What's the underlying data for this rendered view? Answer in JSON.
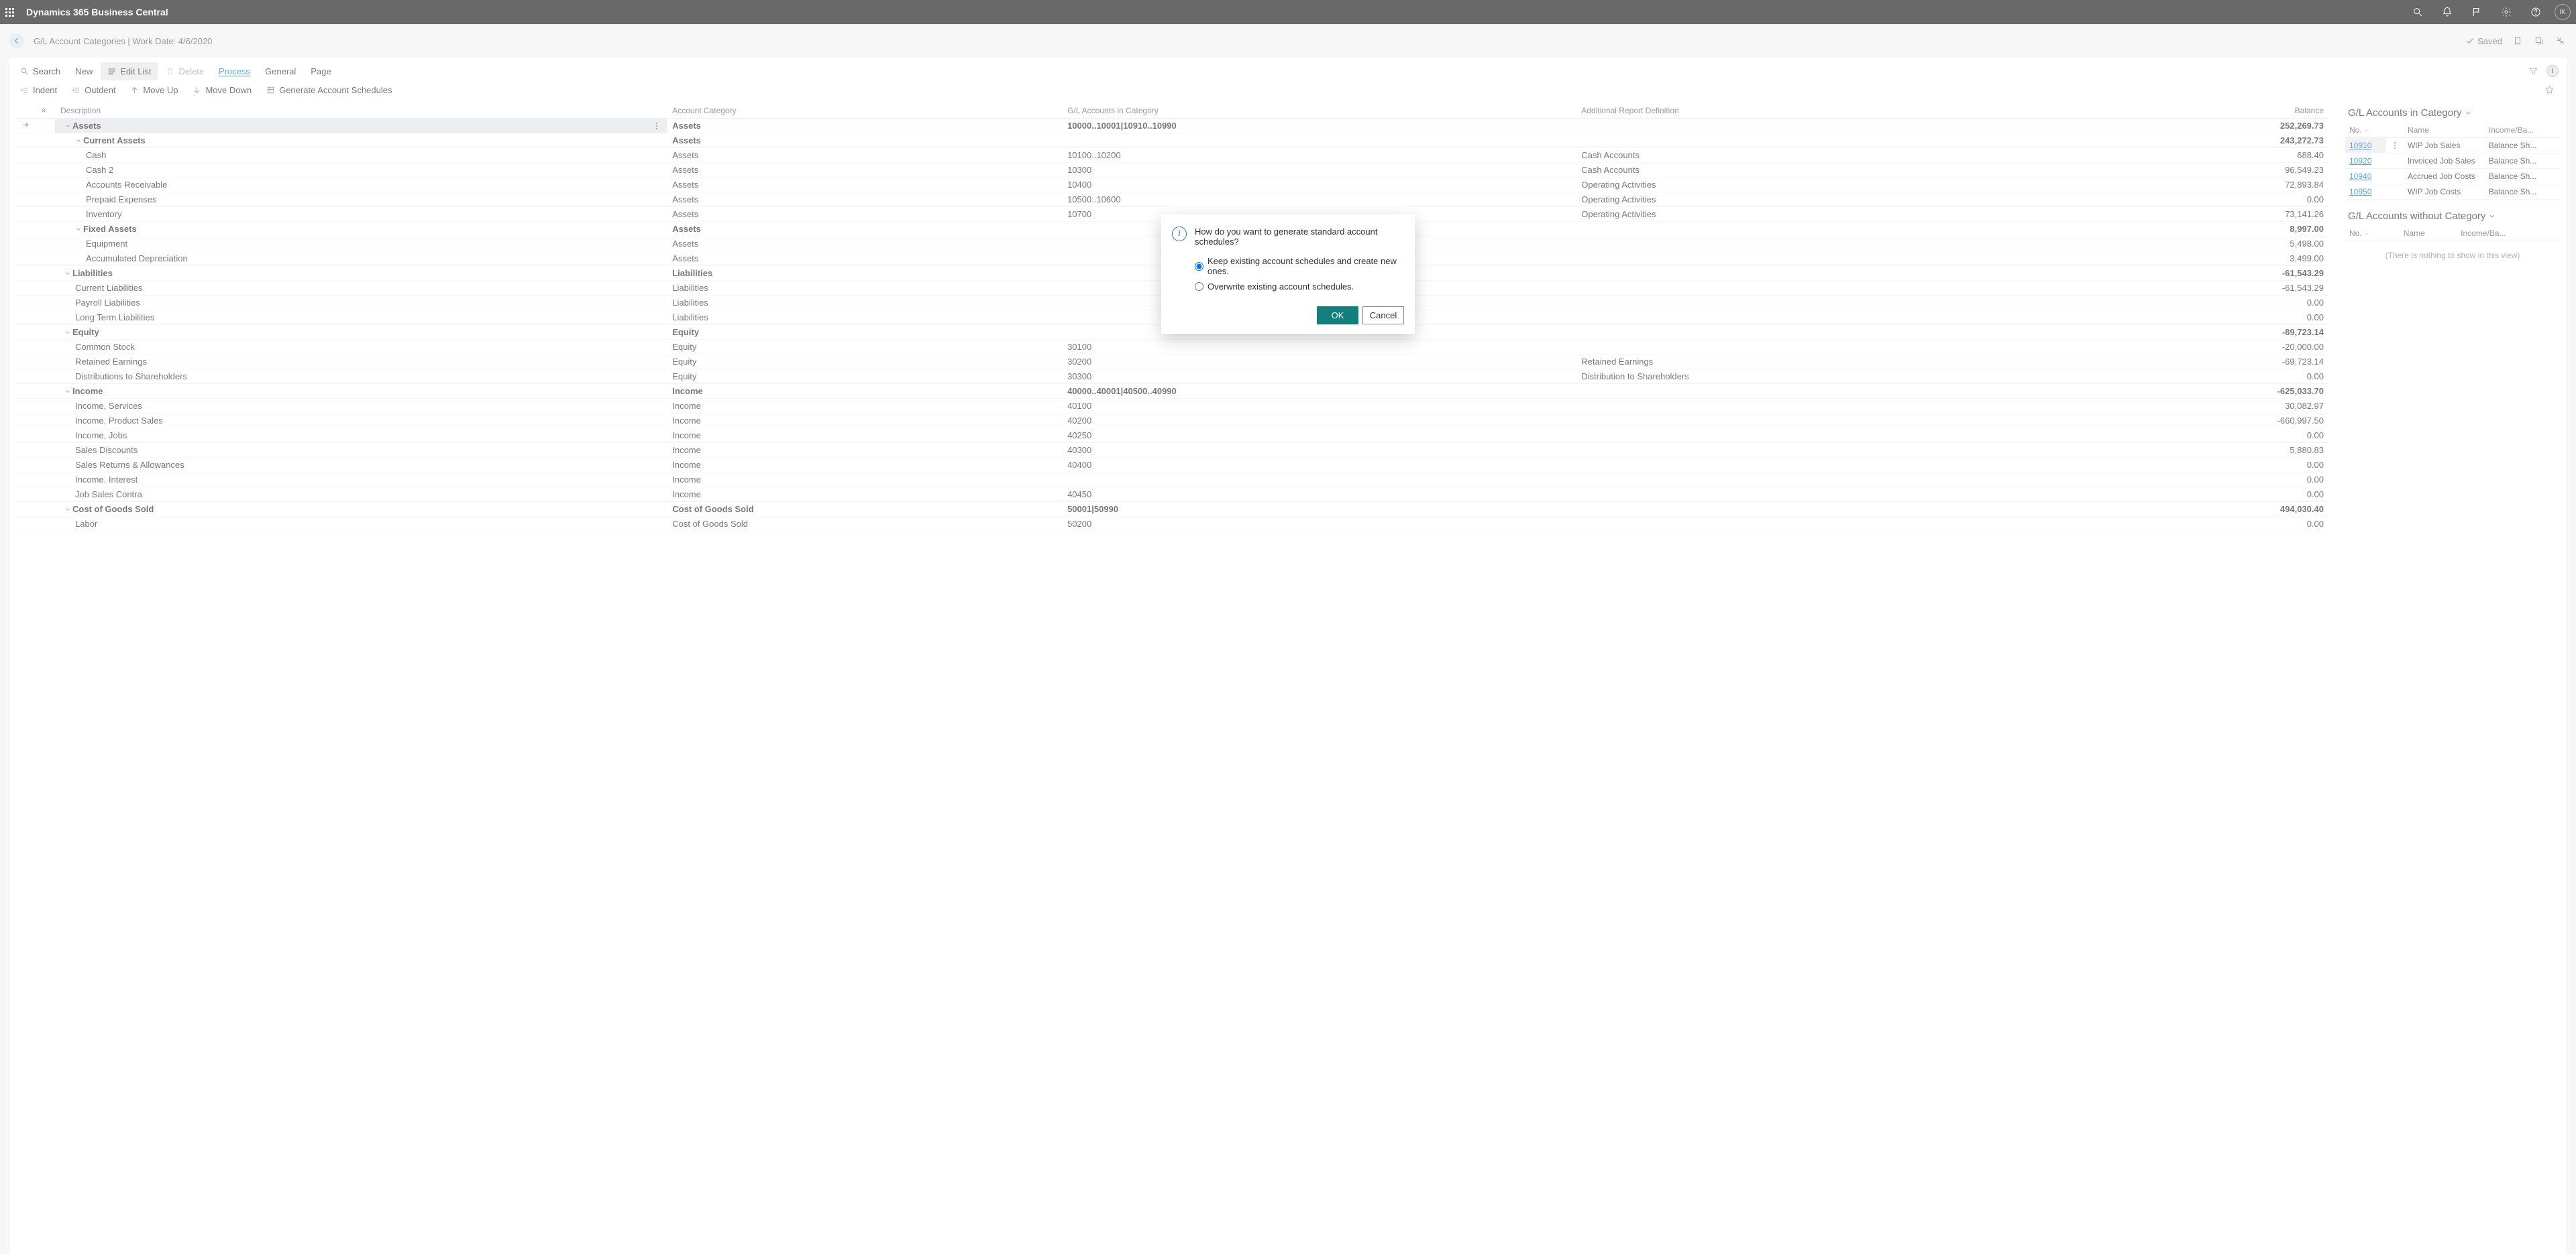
{
  "app_title": "Dynamics 365 Business Central",
  "avatar_initials": "IK",
  "breadcrumb": "G/L Account Categories | Work Date: 4/6/2020",
  "saved_label": "Saved",
  "toolbar1": {
    "search": "Search",
    "new": "New",
    "edit_list": "Edit List",
    "delete": "Delete",
    "process": "Process",
    "general": "General",
    "page": "Page"
  },
  "toolbar2": {
    "indent": "Indent",
    "outdent": "Outdent",
    "move_up": "Move Up",
    "move_down": "Move Down",
    "gen_sched": "Generate Account Schedules"
  },
  "grid_headers": {
    "description": "Description",
    "category": "Account Category",
    "accounts": "G/L Accounts in Category",
    "addl": "Additional Report Definition",
    "balance": "Balance"
  },
  "rows": [
    {
      "indent": 0,
      "expand": true,
      "bold": true,
      "selected": true,
      "desc": "Assets",
      "cat": "Assets",
      "acc": "10000..10001|10910..10990",
      "addl": "",
      "bal": "252,269.73"
    },
    {
      "indent": 1,
      "expand": true,
      "bold": true,
      "desc": "Current Assets",
      "cat": "Assets",
      "acc": "",
      "addl": "",
      "bal": "243,272.73"
    },
    {
      "indent": 2,
      "desc": "Cash",
      "cat": "Assets",
      "acc": "10100..10200",
      "addl": "Cash Accounts",
      "bal": "688.40"
    },
    {
      "indent": 2,
      "desc": "Cash 2",
      "cat": "Assets",
      "acc": "10300",
      "addl": "Cash Accounts",
      "bal": "96,549.23"
    },
    {
      "indent": 2,
      "desc": "Accounts Receivable",
      "cat": "Assets",
      "acc": "10400",
      "addl": "Operating Activities",
      "bal": "72,893.84"
    },
    {
      "indent": 2,
      "desc": "Prepaid Expenses",
      "cat": "Assets",
      "acc": "10500..10600",
      "addl": "Operating Activities",
      "bal": "0.00"
    },
    {
      "indent": 2,
      "desc": "Inventory",
      "cat": "Assets",
      "acc": "10700",
      "addl": "Operating Activities",
      "bal": "73,141.26"
    },
    {
      "indent": 1,
      "expand": true,
      "bold": true,
      "desc": "Fixed Assets",
      "cat": "Assets",
      "acc": "",
      "addl": "",
      "bal": "8,997.00"
    },
    {
      "indent": 2,
      "desc": "Equipment",
      "cat": "Assets",
      "acc": "",
      "addl": "",
      "bal": "5,498.00"
    },
    {
      "indent": 2,
      "desc": "Accumulated Depreciation",
      "cat": "Assets",
      "acc": "",
      "addl": "",
      "bal": "3,499.00"
    },
    {
      "indent": 0,
      "expand": true,
      "bold": true,
      "desc": "Liabilities",
      "cat": "Liabilities",
      "acc": "",
      "addl": "",
      "bal": "-61,543.29"
    },
    {
      "indent": 1,
      "desc": "Current Liabilities",
      "cat": "Liabilities",
      "acc": "",
      "addl": "",
      "bal": "-61,543.29"
    },
    {
      "indent": 1,
      "desc": "Payroll Liabilities",
      "cat": "Liabilities",
      "acc": "",
      "addl": "",
      "bal": "0.00"
    },
    {
      "indent": 1,
      "desc": "Long Term Liabilities",
      "cat": "Liabilities",
      "acc": "",
      "addl": "",
      "bal": "0.00"
    },
    {
      "indent": 0,
      "expand": true,
      "bold": true,
      "desc": "Equity",
      "cat": "Equity",
      "acc": "",
      "addl": "",
      "bal": "-89,723.14"
    },
    {
      "indent": 1,
      "desc": "Common Stock",
      "cat": "Equity",
      "acc": "30100",
      "addl": "",
      "bal": "-20,000.00"
    },
    {
      "indent": 1,
      "desc": "Retained Earnings",
      "cat": "Equity",
      "acc": "30200",
      "addl": "Retained Earnings",
      "bal": "-69,723.14"
    },
    {
      "indent": 1,
      "desc": "Distributions to Shareholders",
      "cat": "Equity",
      "acc": "30300",
      "addl": "Distribution to Shareholders",
      "bal": "0.00"
    },
    {
      "indent": 0,
      "expand": true,
      "bold": true,
      "desc": "Income",
      "cat": "Income",
      "acc": "40000..40001|40500..40990",
      "addl": "",
      "bal": "-625,033.70"
    },
    {
      "indent": 1,
      "desc": "Income, Services",
      "cat": "Income",
      "acc": "40100",
      "addl": "",
      "bal": "30,082.97"
    },
    {
      "indent": 1,
      "desc": "Income, Product Sales",
      "cat": "Income",
      "acc": "40200",
      "addl": "",
      "bal": "-660,997.50"
    },
    {
      "indent": 1,
      "desc": "Income, Jobs",
      "cat": "Income",
      "acc": "40250",
      "addl": "",
      "bal": "0.00"
    },
    {
      "indent": 1,
      "desc": "Sales Discounts",
      "cat": "Income",
      "acc": "40300",
      "addl": "",
      "bal": "5,880.83"
    },
    {
      "indent": 1,
      "desc": "Sales Returns & Allowances",
      "cat": "Income",
      "acc": "40400",
      "addl": "",
      "bal": "0.00"
    },
    {
      "indent": 1,
      "desc": "Income, Interest",
      "cat": "Income",
      "acc": "",
      "addl": "",
      "bal": "0.00"
    },
    {
      "indent": 1,
      "desc": "Job Sales Contra",
      "cat": "Income",
      "acc": "40450",
      "addl": "",
      "bal": "0.00"
    },
    {
      "indent": 0,
      "expand": true,
      "bold": true,
      "desc": "Cost of Goods Sold",
      "cat": "Cost of Goods Sold",
      "acc": "50001|50990",
      "addl": "",
      "bal": "494,030.40"
    },
    {
      "indent": 1,
      "desc": "Labor",
      "cat": "Cost of Goods Sold",
      "acc": "50200",
      "addl": "",
      "bal": "0.00"
    }
  ],
  "side_in_cat": {
    "title": "G/L Accounts in Category",
    "no": "No.",
    "name": "Name",
    "ibs": "Income/Ba...",
    "rows": [
      {
        "no": "10910",
        "name": "WIP Job Sales",
        "ibs": "Balance Sh...",
        "sel": true
      },
      {
        "no": "10920",
        "name": "Invoiced Job Sales",
        "ibs": "Balance Sh..."
      },
      {
        "no": "10940",
        "name": "Accrued Job Costs",
        "ibs": "Balance Sh..."
      },
      {
        "no": "10950",
        "name": "WIP Job Costs",
        "ibs": "Balance Sh..."
      }
    ]
  },
  "side_no_cat": {
    "title": "G/L Accounts without Category",
    "no": "No.",
    "name": "Name",
    "ibs": "Income/Ba...",
    "empty": "(There is nothing to show in this view)"
  },
  "dialog": {
    "message": "How do you want to generate standard account schedules?",
    "opt_keep": "Keep existing account schedules and create new ones.",
    "opt_overwrite": "Overwrite existing account schedules.",
    "ok": "OK",
    "cancel": "Cancel"
  }
}
